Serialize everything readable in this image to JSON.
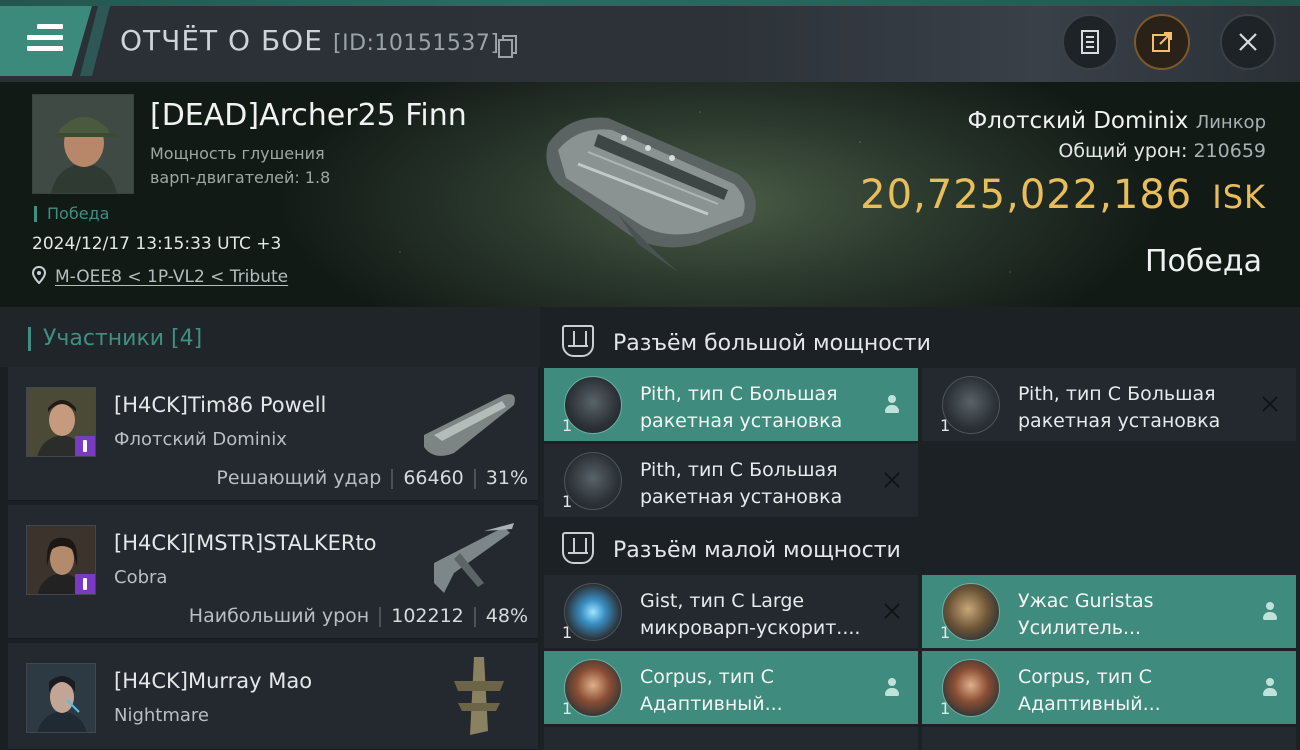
{
  "header": {
    "title": "ОТЧЁТ О БОЕ",
    "report_id": "[ID:10151537]"
  },
  "victim": {
    "name": "[DEAD]Archer25 Finn",
    "stat_label": "Мощность глушения",
    "stat_line2": "варп-двигателей: 1.8",
    "tag": "Победа",
    "datetime": "2024/12/17 13:15:33 UTC +3",
    "location": "M-OEE8 < 1P-VL2 < Tribute",
    "ship_name": "Флотский Dominix",
    "ship_class": "Линкор",
    "damage_label": "Общий урон:",
    "damage_value": "210659",
    "isk_value": "20,725,022,186",
    "isk_unit": "ISK",
    "outcome": "Победа"
  },
  "participants": {
    "title": "Участники [4]",
    "items": [
      {
        "name": "[H4CK]Tim86 Powell",
        "ship": "Флотский Dominix",
        "label": "Решающий удар",
        "damage": "66460",
        "percent": "31%"
      },
      {
        "name": "[H4CK][MSTR]STALKERto",
        "ship": "Cobra",
        "label": "Наибольший урон",
        "damage": "102212",
        "percent": "48%"
      },
      {
        "name": "[H4CK]Murray Mao",
        "ship": "Nightmare",
        "label": "",
        "damage": "",
        "percent": ""
      }
    ]
  },
  "fitting": {
    "high_title": "Разъём большой мощности",
    "low_title": "Разъём малой мощности",
    "high_slots": [
      {
        "name": "Pith, тип C Большая ракетная установка",
        "qty": "1",
        "status": "fitted",
        "status_icon": "person-icon"
      },
      {
        "name": "Pith, тип C Большая ракетная установка",
        "qty": "1",
        "status": "destroyed",
        "status_icon": "x-icon"
      },
      {
        "name": "Pith, тип C Большая ракетная установка",
        "qty": "1",
        "status": "destroyed",
        "status_icon": "x-icon"
      }
    ],
    "low_slots": [
      {
        "name": "Gist, тип C Large микроварп-ускорит....",
        "qty": "1",
        "status": "destroyed",
        "status_icon": "x-icon"
      },
      {
        "name": "Ужас Guristas Усилитель...",
        "qty": "1",
        "status": "fitted",
        "status_icon": "person-icon"
      },
      {
        "name": "Corpus, тип C Адаптивный...",
        "qty": "1",
        "status": "fitted",
        "status_icon": "person-icon"
      },
      {
        "name": "Corpus, тип C Адаптивный...",
        "qty": "1",
        "status": "fitted",
        "status_icon": "person-icon"
      }
    ]
  },
  "colors": {
    "accent": "#3f8b7d",
    "isk": "#e8bd5c"
  }
}
